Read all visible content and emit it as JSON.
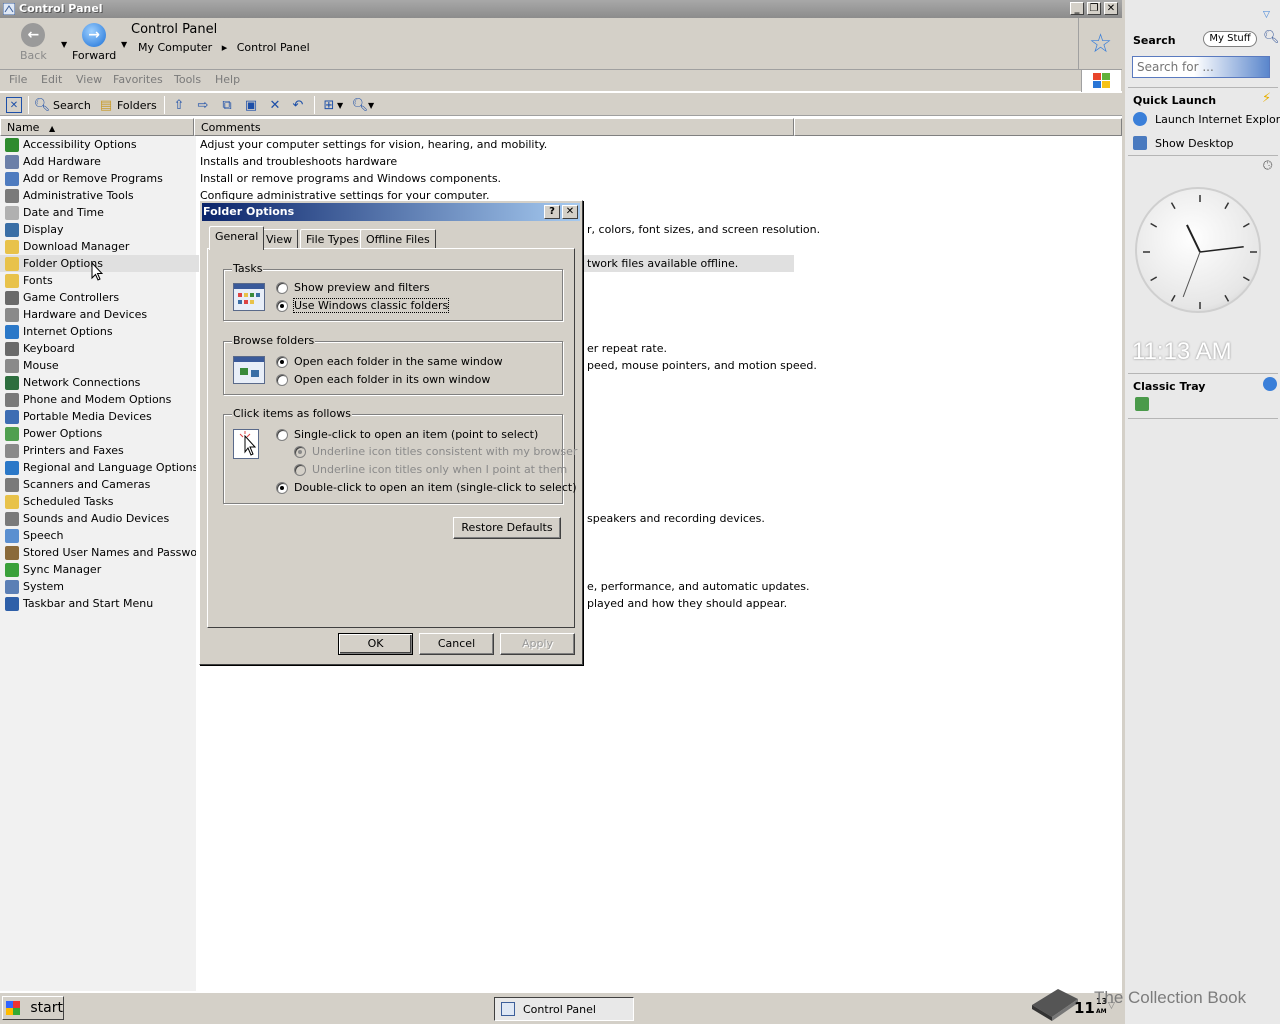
{
  "window": {
    "title": "Control Panel"
  },
  "nav": {
    "back_label": "Back",
    "forward_label": "Forward",
    "address_title": "Control Panel",
    "breadcrumb": [
      "My Computer",
      "Control Panel"
    ]
  },
  "menu": [
    "File",
    "Edit",
    "View",
    "Favorites",
    "Tools",
    "Help"
  ],
  "toolbar": {
    "search_label": "Search",
    "folders_label": "Folders"
  },
  "columns": {
    "name": "Name",
    "comments": "Comments"
  },
  "items": [
    {
      "name": "Accessibility Options",
      "comment": "Adjust your computer settings for vision, hearing, and mobility.",
      "color": "#2e8b2e"
    },
    {
      "name": "Add Hardware",
      "comment": "Installs and troubleshoots hardware",
      "color": "#6b7fa8"
    },
    {
      "name": "Add or Remove Programs",
      "comment": "Install or remove programs and Windows components.",
      "color": "#4e7bbf"
    },
    {
      "name": "Administrative Tools",
      "comment": "Configure administrative settings for your computer.",
      "color": "#7a7a7a"
    },
    {
      "name": "Date and Time",
      "comment": "",
      "color": "#b0b0b0"
    },
    {
      "name": "Display",
      "comment": "",
      "color": "#3a6ea5"
    },
    {
      "name": "Download Manager",
      "comment": "",
      "color": "#e8c24a"
    },
    {
      "name": "Folder Options",
      "comment": "",
      "color": "#e8c24a"
    },
    {
      "name": "Fonts",
      "comment": "",
      "color": "#e8c24a"
    },
    {
      "name": "Game Controllers",
      "comment": "",
      "color": "#6a6a6a"
    },
    {
      "name": "Hardware and Devices",
      "comment": "",
      "color": "#8a8a8a"
    },
    {
      "name": "Internet Options",
      "comment": "",
      "color": "#2b78c8"
    },
    {
      "name": "Keyboard",
      "comment": "",
      "color": "#6a6a6a"
    },
    {
      "name": "Mouse",
      "comment": "",
      "color": "#8a8a8a"
    },
    {
      "name": "Network Connections",
      "comment": "",
      "color": "#2d6e3e"
    },
    {
      "name": "Phone and Modem Options",
      "comment": "",
      "color": "#7a7a7a"
    },
    {
      "name": "Portable Media Devices",
      "comment": "",
      "color": "#3d6db3"
    },
    {
      "name": "Power Options",
      "comment": "",
      "color": "#4f9f4f"
    },
    {
      "name": "Printers and Faxes",
      "comment": "",
      "color": "#8a8a8a"
    },
    {
      "name": "Regional and Language Options",
      "comment": "",
      "color": "#2b78c8"
    },
    {
      "name": "Scanners and Cameras",
      "comment": "",
      "color": "#7a7a7a"
    },
    {
      "name": "Scheduled Tasks",
      "comment": "",
      "color": "#e8c24a"
    },
    {
      "name": "Sounds and Audio Devices",
      "comment": "",
      "color": "#7a7a7a"
    },
    {
      "name": "Speech",
      "comment": "",
      "color": "#5a8fd0"
    },
    {
      "name": "Stored User Names and Passwords",
      "comment": "",
      "color": "#8a6a3a"
    },
    {
      "name": "Sync Manager",
      "comment": "",
      "color": "#3aa03a"
    },
    {
      "name": "System",
      "comment": "",
      "color": "#5b7fb5"
    },
    {
      "name": "Taskbar and Start Menu",
      "comment": "",
      "color": "#2e5fa8"
    }
  ],
  "partial_comments": [
    {
      "row": 5,
      "text": "r, colors, font sizes, and screen resolution."
    },
    {
      "row": 7,
      "text": "twork files available offline."
    },
    {
      "row": 12,
      "text": "er repeat rate."
    },
    {
      "row": 13,
      "text": "peed, mouse pointers, and motion speed."
    },
    {
      "row": 22,
      "text": "speakers and recording devices."
    },
    {
      "row": 26,
      "text": "e, performance, and automatic updates."
    },
    {
      "row": 27,
      "text": "played and how they should appear."
    }
  ],
  "dialog": {
    "title": "Folder Options",
    "help_btn": "?",
    "close_btn": "✕",
    "tabs": [
      "General",
      "View",
      "File Types",
      "Offline Files"
    ],
    "tasks": {
      "title": "Tasks",
      "opt1": "Show preview and filters",
      "opt2": "Use Windows classic folders"
    },
    "browse": {
      "title": "Browse folders",
      "opt1": "Open each folder in the same window",
      "opt2": "Open each folder in its own window"
    },
    "click": {
      "title": "Click items as follows",
      "opt1": "Single-click to open an item (point to select)",
      "sub1": "Underline icon titles consistent with my browser",
      "sub2": "Underline icon titles only when I point at them",
      "opt2": "Double-click to open an item (single-click to select)"
    },
    "restore": "Restore Defaults",
    "ok": "OK",
    "cancel": "Cancel",
    "apply": "Apply"
  },
  "sidebar": {
    "search_title": "Search",
    "mystuff": "My Stuff",
    "search_placeholder": "Search for ...",
    "quick_launch": "Quick Launch",
    "ql_items": [
      "Launch Internet Explore",
      "Show Desktop"
    ],
    "clock_time": "11:13 AM",
    "classic_tray": "Classic Tray"
  },
  "taskbar": {
    "start": "start",
    "task": "Control Panel",
    "clock": "11",
    "clock_small": "13",
    "clock_ampm": "AM",
    "watermark": "The Collection Book"
  },
  "colors": {
    "title_active": "#0a246a",
    "title_gradient_end": "#a6caf0",
    "window_face": "#d4d0c8"
  }
}
